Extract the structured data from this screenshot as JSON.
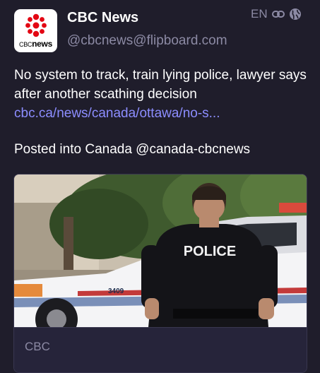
{
  "account": {
    "display_name": "CBC News",
    "handle": "@cbcnews@flipboard.com",
    "avatar_brand_prefix": "CBC",
    "avatar_brand_suffix": "news",
    "avatar_icon": "cbc-gem-logo"
  },
  "meta": {
    "language": "EN",
    "link_icon": "link-icon",
    "visibility_icon": "globe-icon"
  },
  "post": {
    "text": "No system to track, train lying police, lawyer says after another scathing decision",
    "link_text": "cbc.ca/news/canada/ottawa/no-s...",
    "posted_line": "Posted into Canada @canada-cbcnews"
  },
  "card": {
    "image_badge_text": "POLICE",
    "car_number": "3409",
    "source": "CBC"
  },
  "colors": {
    "background": "#1f1d2b",
    "muted": "#8c8aa4",
    "link": "#8c8dff",
    "cbc_red": "#e30613"
  }
}
